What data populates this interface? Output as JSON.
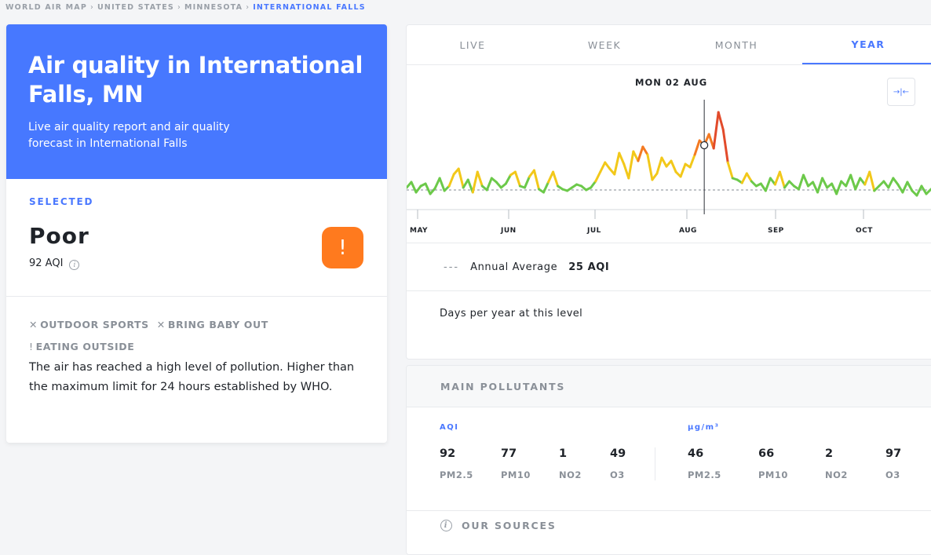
{
  "breadcrumb": [
    "WORLD AIR MAP",
    "UNITED STATES",
    "MINNESOTA",
    "INTERNATIONAL FALLS"
  ],
  "hero": {
    "title": "Air quality in International Falls, MN",
    "subtitle": "Live air quality report and air quality forecast in International Falls"
  },
  "status": {
    "selected_label": "SELECTED",
    "level": "Poor",
    "aqi": "92 AQI",
    "badge": "!",
    "recommendations": [
      {
        "mark": "✕",
        "label": "OUTDOOR SPORTS"
      },
      {
        "mark": "✕",
        "label": "BRING BABY OUT"
      },
      {
        "mark": "!",
        "label": "EATING OUTSIDE"
      }
    ],
    "description": "The air has reached a high level of pollution. Higher than the maximum limit for 24 hours established by WHO."
  },
  "tabs": [
    {
      "label": "LIVE",
      "active": false
    },
    {
      "label": "WEEK",
      "active": false
    },
    {
      "label": "MONTH",
      "active": false
    },
    {
      "label": "YEAR",
      "active": true
    }
  ],
  "chart": {
    "date_label": "MON 02 AUG",
    "collapse_icon": "→|←",
    "annual_average_label": "Annual Average",
    "annual_average_value": "25 AQI",
    "days_label": "Days per year at this level"
  },
  "chart_data": {
    "type": "line",
    "x_labels": [
      "MAY",
      "JUN",
      "JUL",
      "AUG",
      "SEP",
      "OCT"
    ],
    "annual_average": 25,
    "ylim": [
      0,
      130
    ],
    "selected_index": 63,
    "colors": {
      "good": "#6cc94a",
      "moderate": "#f2c81a",
      "poor": "#f47a22",
      "unhealthy": "#e24b2b"
    },
    "values": [
      28,
      35,
      22,
      30,
      33,
      20,
      27,
      40,
      24,
      30,
      45,
      52,
      28,
      38,
      22,
      48,
      30,
      25,
      40,
      35,
      28,
      33,
      44,
      48,
      30,
      28,
      42,
      50,
      26,
      22,
      35,
      48,
      30,
      26,
      24,
      28,
      32,
      30,
      25,
      28,
      36,
      48,
      60,
      52,
      45,
      72,
      58,
      40,
      74,
      62,
      80,
      70,
      38,
      46,
      66,
      55,
      62,
      48,
      42,
      58,
      54,
      70,
      88,
      82,
      96,
      78,
      124,
      102,
      60,
      40,
      38,
      34,
      46,
      36,
      30,
      33,
      24,
      40,
      32,
      48,
      28,
      36,
      30,
      26,
      44,
      30,
      35,
      22,
      40,
      28,
      33,
      20,
      36,
      30,
      44,
      26,
      40,
      32,
      48,
      24,
      30,
      36,
      28,
      40,
      32,
      22,
      35,
      24,
      18,
      30,
      20,
      26
    ]
  },
  "pollutants": {
    "title": "MAIN POLLUTANTS",
    "aqi_label": "AQI",
    "conc_label": "µg/m³",
    "aqi": [
      {
        "value": "92",
        "name": "PM2.5"
      },
      {
        "value": "77",
        "name": "PM10"
      },
      {
        "value": "1",
        "name": "NO2"
      },
      {
        "value": "49",
        "name": "O3"
      }
    ],
    "conc": [
      {
        "value": "46",
        "name": "PM2.5"
      },
      {
        "value": "66",
        "name": "PM10"
      },
      {
        "value": "2",
        "name": "NO2"
      },
      {
        "value": "97",
        "name": "O3"
      }
    ],
    "sources_label": "OUR SOURCES"
  }
}
